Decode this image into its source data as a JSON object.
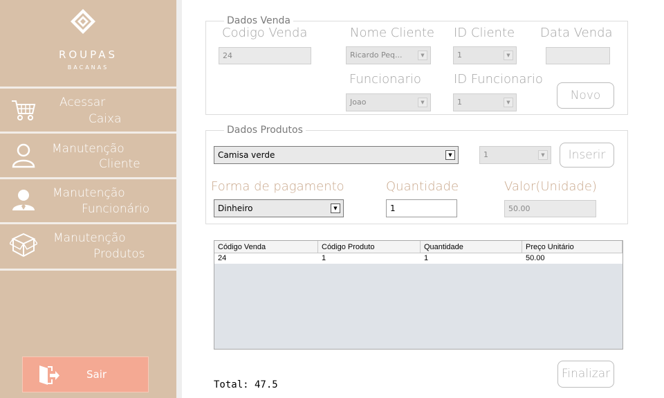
{
  "sidebar": {
    "brand": "ROUPAS",
    "brand_sub": "BACANAS",
    "items": [
      {
        "line1": "Acessar",
        "line2": "Caixa",
        "icon": "shopping-cart-icon"
      },
      {
        "line1": "Manutenção",
        "line2": "Cliente",
        "icon": "user-icon"
      },
      {
        "line1": "Manutenção",
        "line2": "Funcionário",
        "icon": "employee-icon"
      },
      {
        "line1": "Manutenção",
        "line2": "Produtos",
        "icon": "box-icon"
      }
    ],
    "exit_label": "Sair"
  },
  "venda": {
    "title": "Dados Venda",
    "codigo_label": "Codigo Venda",
    "codigo_value": "24",
    "nome_cliente_label": "Nome Cliente",
    "nome_cliente_value": "Ricardo Peq...",
    "id_cliente_label": "ID Cliente",
    "id_cliente_value": "1",
    "data_label": "Data Venda",
    "data_value": "",
    "funcionario_label": "Funcionario",
    "funcionario_value": "Joao",
    "id_funcionario_label": "ID Funcionario",
    "id_funcionario_value": "1",
    "novo_label": "Novo"
  },
  "produtos": {
    "title": "Dados Produtos",
    "produto_value": "Camisa verde",
    "produto_id_value": "1",
    "inserir_label": "Inserir",
    "pagamento_label": "Forma de pagamento",
    "pagamento_value": "Dinheiro",
    "quantidade_label": "Quantidade",
    "quantidade_value": "1",
    "valor_label": "Valor(Unidade)",
    "valor_value": "50.00"
  },
  "table": {
    "headers": [
      "Código Venda",
      "Código Produto",
      "Quantidade",
      "Preço Unitário"
    ],
    "rows": [
      [
        "24",
        "1",
        "1",
        "50.00"
      ]
    ]
  },
  "footer": {
    "total_label": "Total: 47.5",
    "finalizar_label": "Finalizar"
  },
  "colors": {
    "sidebar": "#d8c0a8",
    "exit_button": "#f4a993",
    "accent_label": "#c9a88c"
  }
}
